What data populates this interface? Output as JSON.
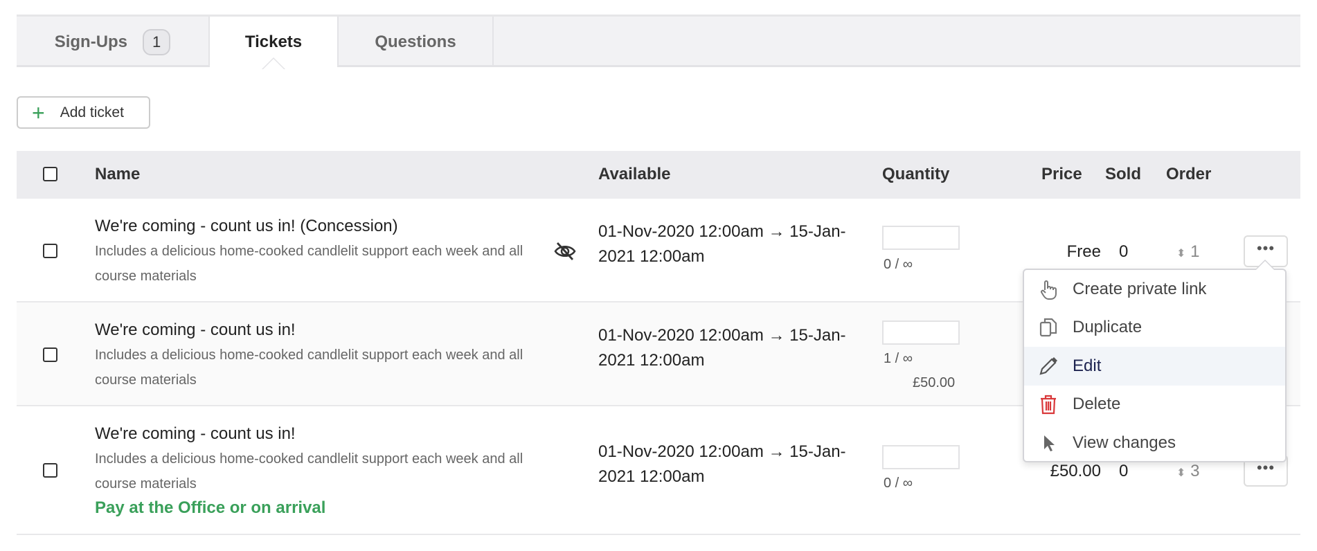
{
  "tabs": [
    {
      "label": "Sign-Ups",
      "badge": "1"
    },
    {
      "label": "Tickets"
    },
    {
      "label": "Questions"
    }
  ],
  "toolbar": {
    "add_ticket": "Add ticket"
  },
  "table": {
    "headers": {
      "name": "Name",
      "available": "Available",
      "quantity": "Quantity",
      "price": "Price",
      "sold": "Sold",
      "order": "Order"
    },
    "rows": [
      {
        "name": "We're coming - count us in! (Concession)",
        "description": "Includes a delicious home-cooked candlelit support each week and all course materials",
        "available": "01-Nov-2020 12:00am → 15-Jan-2021 12:00am",
        "quantity": "0 / ∞",
        "price": "Free",
        "sold": "0",
        "order": "1",
        "hidden": true
      },
      {
        "name": "We're coming - count us in!",
        "description": "Includes a delicious home-cooked candlelit support each week and all course materials",
        "available": "01-Nov-2020 12:00am → 15-Jan-2021 12:00am",
        "quantity": "1 / ∞",
        "sub_price": "£50.00"
      },
      {
        "name": "We're coming - count us in!",
        "description": "Includes a delicious home-cooked candlelit support each week and all course materials",
        "available": "01-Nov-2020 12:00am → 15-Jan-2021 12:00am",
        "quantity": "0 / ∞",
        "price": "£50.00",
        "sold": "0",
        "order": "3",
        "note": "Pay at the Office or on arrival"
      }
    ]
  },
  "menu": {
    "items": [
      "Create private link",
      "Duplicate",
      "Edit",
      "Delete",
      "View changes"
    ],
    "highlighted": "Edit"
  },
  "colors": {
    "accent_green": "#3aa05a",
    "delete_red": "#d9383a"
  }
}
